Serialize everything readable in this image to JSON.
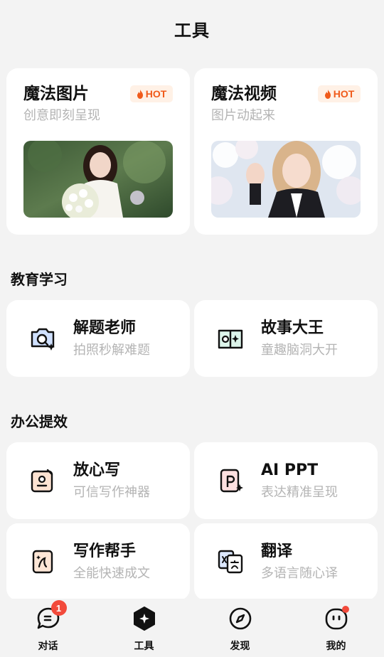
{
  "header": {
    "title": "工具"
  },
  "hero_cards": [
    {
      "title": "魔法图片",
      "subtitle": "创意即刻呈现",
      "badge": "HOT",
      "image_desc": "woman-with-flowers-photo"
    },
    {
      "title": "魔法视频",
      "subtitle": "图片动起来",
      "badge": "HOT",
      "image_desc": "girl-waving-under-cherry-blossoms-photo"
    }
  ],
  "sections": {
    "education": {
      "title": "教育学习",
      "tools": [
        {
          "title": "解题老师",
          "subtitle": "拍照秒解难题",
          "icon": "camera-sparkle-icon"
        },
        {
          "title": "故事大王",
          "subtitle": "童趣脑洞大开",
          "icon": "book-sparkle-icon"
        }
      ]
    },
    "office": {
      "title": "办公提效",
      "tools": [
        {
          "title": "放心写",
          "subtitle": "可信写作神器",
          "icon": "pen-check-icon"
        },
        {
          "title": "AI PPT",
          "subtitle": "表达精准呈现",
          "icon": "ppt-sparkle-icon"
        },
        {
          "title": "写作帮手",
          "subtitle": "全能快速成文",
          "icon": "writing-doc-icon"
        },
        {
          "title": "翻译",
          "subtitle": "多语言随心译",
          "icon": "translate-icon"
        }
      ]
    }
  },
  "tabbar": {
    "items": [
      {
        "label": "对话",
        "icon": "chat-icon",
        "badge": "1"
      },
      {
        "label": "工具",
        "icon": "tools-icon",
        "active": true
      },
      {
        "label": "发现",
        "icon": "compass-icon"
      },
      {
        "label": "我的",
        "icon": "profile-icon",
        "dot": true
      }
    ]
  },
  "colors": {
    "background": "#f3f3f3",
    "card": "#ffffff",
    "hot": "#f05a1a",
    "badge": "#f24a3b",
    "subtitle": "#b4b4b4"
  }
}
